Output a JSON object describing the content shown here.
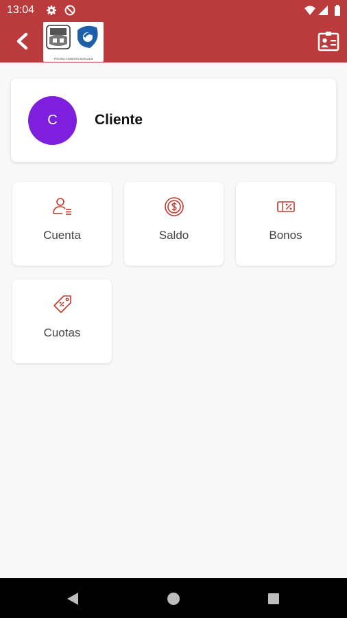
{
  "status_bar": {
    "time": "13:04"
  },
  "app_bar": {
    "logo_caption": "PISCINA CUBIERTA BURLADA"
  },
  "profile": {
    "avatar_initial": "C",
    "name": "Cliente"
  },
  "tiles": [
    {
      "label": "Cuenta",
      "icon": "user-list-icon"
    },
    {
      "label": "Saldo",
      "icon": "dollar-coin-icon"
    },
    {
      "label": "Bonos",
      "icon": "voucher-percent-icon"
    },
    {
      "label": "Cuotas",
      "icon": "price-tag-icon"
    }
  ],
  "colors": {
    "primary": "#bb3a3c",
    "avatar": "#7f1fde",
    "icon": "#c0392b",
    "background": "#f8f8f8"
  }
}
